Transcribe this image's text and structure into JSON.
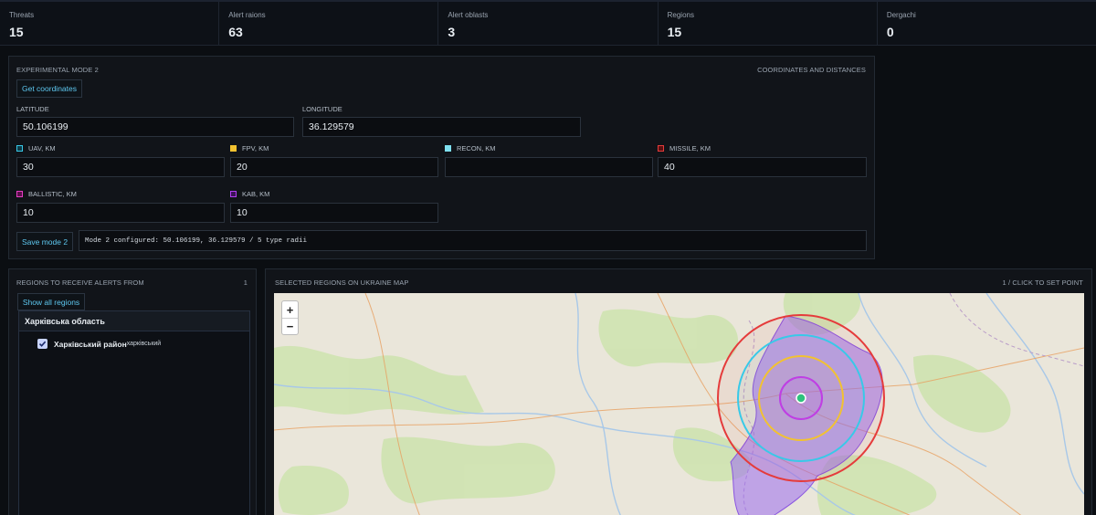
{
  "stats": [
    {
      "label": "Threats",
      "value": "15"
    },
    {
      "label": "Alert raions",
      "value": "63"
    },
    {
      "label": "Alert oblasts",
      "value": "3"
    },
    {
      "label": "Regions",
      "value": "15"
    },
    {
      "label": "Dergachi",
      "value": "0"
    }
  ],
  "mode_panel": {
    "title": "EXPERIMENTAL MODE 2",
    "subtitle": "COORDINATES AND DISTANCES",
    "get_coordinates": "Get coordinates",
    "latitude_label": "LATITUDE",
    "latitude_value": "50.106199",
    "longitude_label": "LONGITUDE",
    "longitude_value": "36.129579",
    "uav_label": "UAV, KM",
    "uav_value": "30",
    "uav_color": "#38c9e8",
    "fpv_label": "FPV, KM",
    "fpv_value": "20",
    "fpv_color": "#f2c230",
    "recon_label": "RECON, KM",
    "recon_value": "",
    "recon_color": "#7fe0f0",
    "missile_label": "MISSILE, KM",
    "missile_value": "40",
    "missile_color": "#e53b3b",
    "ballistic_label": "BALLISTIC, KM",
    "ballistic_value": "10",
    "ballistic_color": "#e63ec4",
    "kab_label": "KAB, KM",
    "kab_value": "10",
    "kab_color": "#b13ef0",
    "save_label": "Save mode 2",
    "status": "Mode 2 configured: 50.106199, 36.129579 / 5 type radii"
  },
  "regions_panel": {
    "title": "REGIONS TO RECEIVE ALERTS FROM",
    "count": "1",
    "show_all": "Show all regions",
    "oblast": "Харківська область",
    "district": "Харківський район",
    "district_sub": "харківський"
  },
  "map_panel": {
    "title": "SELECTED REGIONS ON UKRAINE MAP",
    "hint": "1 / CLICK TO SET POINT",
    "zoom_in": "+",
    "zoom_out": "−"
  }
}
